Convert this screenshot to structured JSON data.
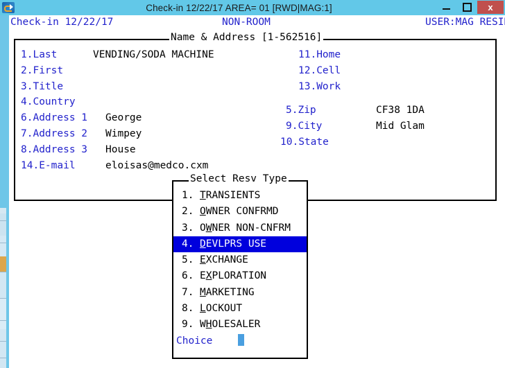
{
  "window": {
    "icon": "app-icon",
    "title": "Check-in 12/22/17  AREA= 01 [RWD|MAG:1]",
    "minimize_label": "",
    "maximize_label": "",
    "close_label": "x"
  },
  "status_line": {
    "left": "Check-in 12/22/17",
    "center": "NON-ROOM",
    "right": "USER:MAG RESIN"
  },
  "panel": {
    "title": "Name & Address [1-562516]",
    "left_fields": [
      {
        "label": "1.Last",
        "value": "VENDING/SODA MACHINE"
      },
      {
        "label": "2.First",
        "value": ""
      },
      {
        "label": "3.Title",
        "value": ""
      },
      {
        "label": "4.Country",
        "value": ""
      },
      {
        "label": "6.Address 1",
        "value": "George"
      },
      {
        "label": "7.Address 2",
        "value": "Wimpey"
      },
      {
        "label": "8.Address 3",
        "value": "House"
      },
      {
        "label": "14.E-mail",
        "value": "eloisas@medco.cxm"
      }
    ],
    "right_fields": [
      {
        "label": "11.Home",
        "value": ""
      },
      {
        "label": "12.Cell",
        "value": ""
      },
      {
        "label": "13.Work",
        "value": ""
      },
      {
        "label": "5.Zip",
        "value": "CF38 1DA"
      },
      {
        "label": "9.City",
        "value": "Mid Glam"
      },
      {
        "label": "10.State",
        "value": ""
      }
    ]
  },
  "dialog": {
    "title": "Select Resv Type",
    "options": [
      {
        "num": "1.",
        "pre": "",
        "acc": "T",
        "post": "RANSIENTS"
      },
      {
        "num": "2.",
        "pre": "",
        "acc": "O",
        "post": "WNER CONFRMD"
      },
      {
        "num": "3.",
        "pre": "O",
        "acc": "W",
        "post": "NER NON-CNFRM"
      },
      {
        "num": "4.",
        "pre": "",
        "acc": "D",
        "post": "EVLPRS USE"
      },
      {
        "num": "5.",
        "pre": "",
        "acc": "E",
        "post": "XCHANGE"
      },
      {
        "num": "6.",
        "pre": "E",
        "acc": "X",
        "post": "PLORATION"
      },
      {
        "num": "7.",
        "pre": "",
        "acc": "M",
        "post": "ARKETING"
      },
      {
        "num": "8.",
        "pre": "",
        "acc": "L",
        "post": "OCKOUT"
      },
      {
        "num": "9.",
        "pre": "W",
        "acc": "H",
        "post": "OLESALER"
      }
    ],
    "selected_index": 3,
    "choice_label": "Choice",
    "choice_value": ""
  },
  "colors": {
    "titlebar": "#62c8e8",
    "close_button": "#c0504d",
    "terminal_blue": "#2222cc",
    "highlight": "#0000dd",
    "cursor": "#4a9fe0"
  }
}
